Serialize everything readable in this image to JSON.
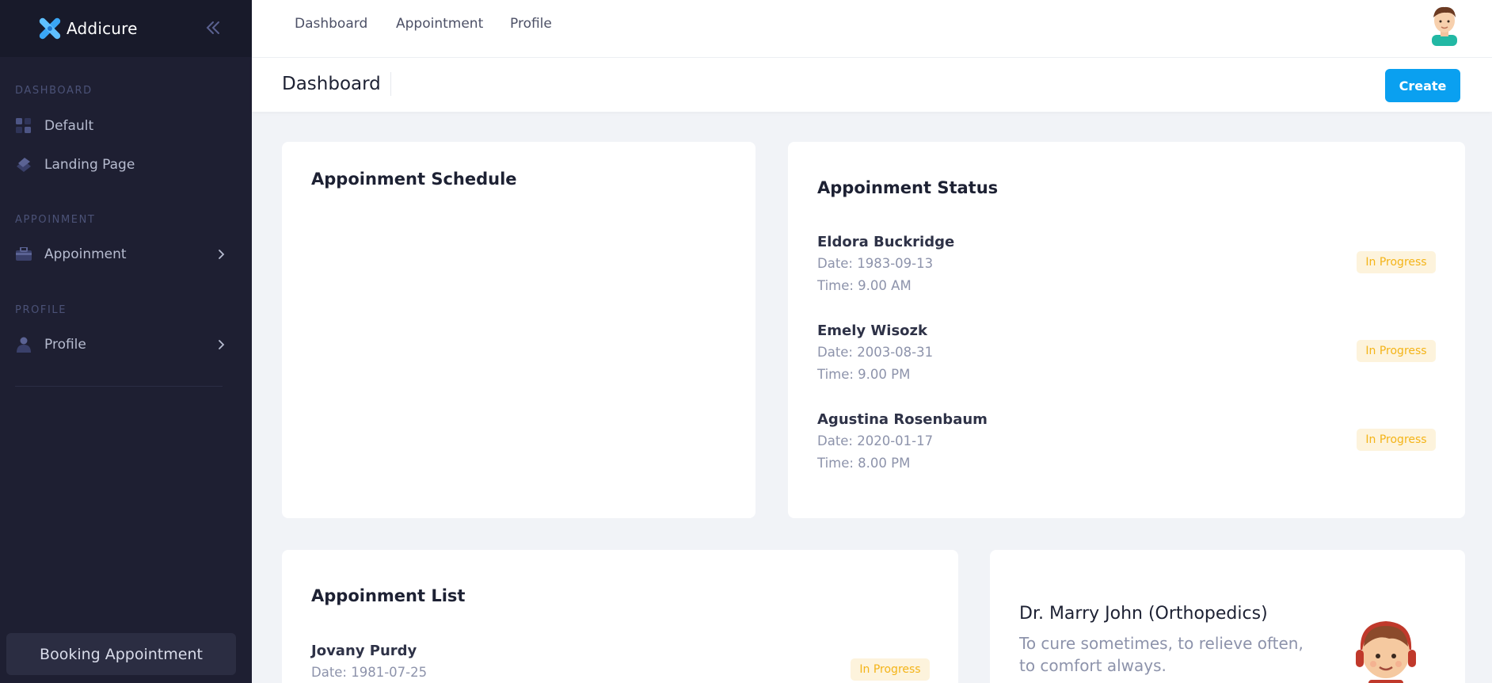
{
  "brand": {
    "name": "Addicure",
    "colors": {
      "sidebar": "#1e1f32",
      "accent": "#0aa0f0",
      "badge_text": "#f4b418",
      "badge_bg": "#fdf3dc"
    }
  },
  "sidebar": {
    "sections": [
      {
        "title": "DASHBOARD",
        "items": [
          {
            "label": "Default",
            "icon": "grid-icon"
          },
          {
            "label": "Landing Page",
            "icon": "layers-icon"
          }
        ]
      },
      {
        "title": "APPOINMENT",
        "items": [
          {
            "label": "Appoinment",
            "icon": "briefcase-icon",
            "has_submenu": true
          }
        ]
      },
      {
        "title": "PROFILE",
        "items": [
          {
            "label": "Profile",
            "icon": "user-icon",
            "has_submenu": true
          }
        ]
      }
    ],
    "footer_button": "Booking Appointment"
  },
  "topnav": {
    "links": [
      "Dashboard",
      "Appointment",
      "Profile"
    ]
  },
  "page": {
    "title": "Dashboard",
    "create_label": "Create"
  },
  "schedule_card": {
    "title": "Appoinment Schedule"
  },
  "status_card": {
    "title": "Appoinment Status",
    "rows": [
      {
        "name": "Eldora Buckridge",
        "date": "Date: 1983-09-13",
        "time": "Time: 9.00 AM",
        "status": "In Progress"
      },
      {
        "name": "Emely Wisozk",
        "date": "Date: 2003-08-31",
        "time": "Time: 9.00 PM",
        "status": "In Progress"
      },
      {
        "name": "Agustina Rosenbaum",
        "date": "Date: 2020-01-17",
        "time": "Time: 8.00 PM",
        "status": "In Progress"
      }
    ]
  },
  "list_card": {
    "title": "Appoinment List",
    "rows": [
      {
        "name": "Jovany Purdy",
        "date": "Date: 1981-07-25",
        "status": "In Progress"
      }
    ]
  },
  "doctor_card": {
    "name": "Dr. Marry John (Orthopedics)",
    "quote": "To cure sometimes, to relieve often, to comfort always."
  }
}
